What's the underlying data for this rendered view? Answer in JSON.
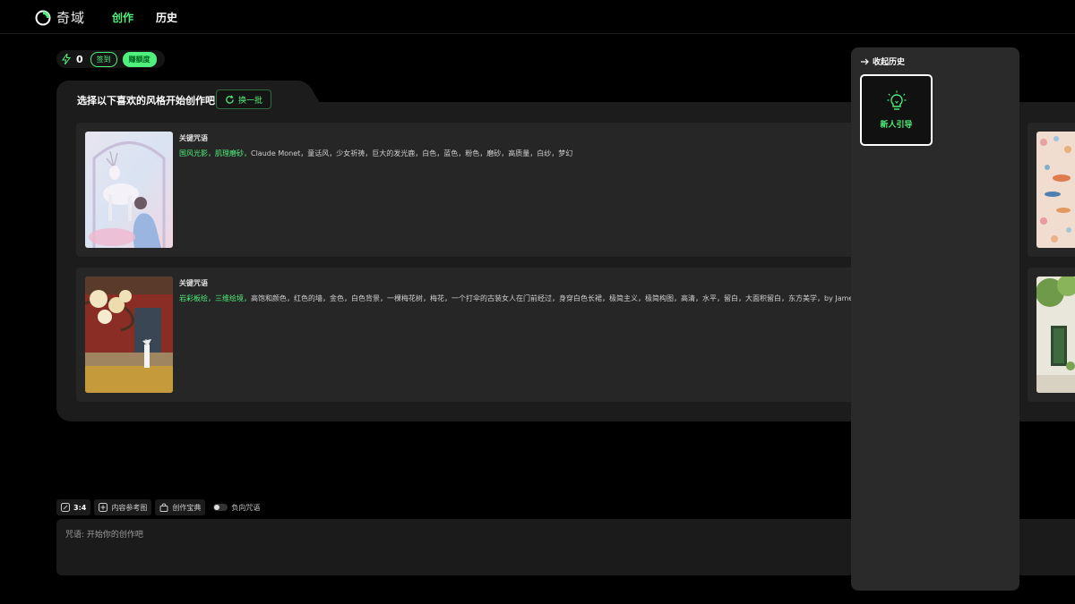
{
  "app": {
    "logo_text": "奇域",
    "nav": {
      "create": "创作",
      "history": "历史"
    }
  },
  "credits": {
    "count": "0",
    "checkin_label": "签到",
    "earn_label": "赚额度"
  },
  "style_panel": {
    "title": "选择以下喜欢的风格开始创作吧",
    "refresh_label": "换一批",
    "cards": [
      {
        "label": "关键咒语",
        "highlight": "国风光影，肌理磨砂，",
        "text": "Claude Monet，童话风，少女祈祷，巨大的发光鹿，白色，蓝色，粉色，磨砂，高质量，白纱，梦幻"
      },
      {
        "label": "关键咒语",
        "highlight": "岩彩板绘，三维绘境，",
        "text": "高饱和颜色，红色的墙，金色，白色背景，一棵梅花树，梅花，一个打伞的古装女人在门前经过，身穿白色长裙，极简主义，极简构图，高清，水平，留白，大面积留白，东方美学，by James Turrell"
      }
    ]
  },
  "toolbar": {
    "ratio": "3:4",
    "reference_label": "内容参考图",
    "treasure_label": "创作宝典",
    "negative_label": "负向咒语"
  },
  "prompt": {
    "placeholder": "咒语: 开始你的创作吧"
  },
  "drawer": {
    "collapse_label": "收起历史",
    "guide_label": "新人引导"
  },
  "colors": {
    "accent": "#4ff07b",
    "background": "#000000",
    "panel": "#1c1c1c",
    "card": "#262626"
  }
}
